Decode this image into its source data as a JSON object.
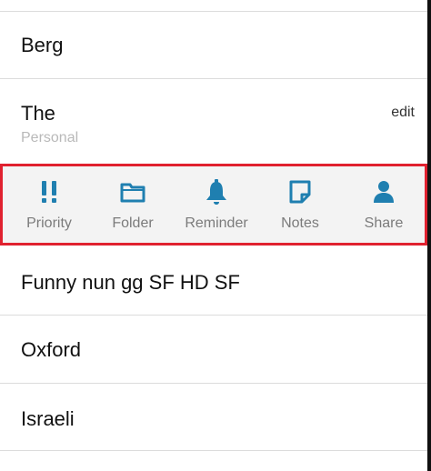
{
  "list": {
    "items": [
      {
        "title": "Berg"
      },
      {
        "title": "The",
        "subtitle": "Personal",
        "edit_label": "edit"
      },
      {
        "title": "Funny nun gg SF HD SF"
      },
      {
        "title": "Oxford"
      },
      {
        "title": "Israeli"
      }
    ]
  },
  "action_bar": {
    "actions": [
      {
        "label": "Priority",
        "icon": "priority-icon"
      },
      {
        "label": "Folder",
        "icon": "folder-icon"
      },
      {
        "label": "Reminder",
        "icon": "bell-icon"
      },
      {
        "label": "Notes",
        "icon": "note-icon"
      },
      {
        "label": "Share",
        "icon": "person-icon"
      }
    ]
  },
  "colors": {
    "icon_blue": "#1f7fb0",
    "highlight_border": "#e0212f",
    "action_label": "#7b7b7b",
    "subtitle": "#b9b9b9"
  }
}
